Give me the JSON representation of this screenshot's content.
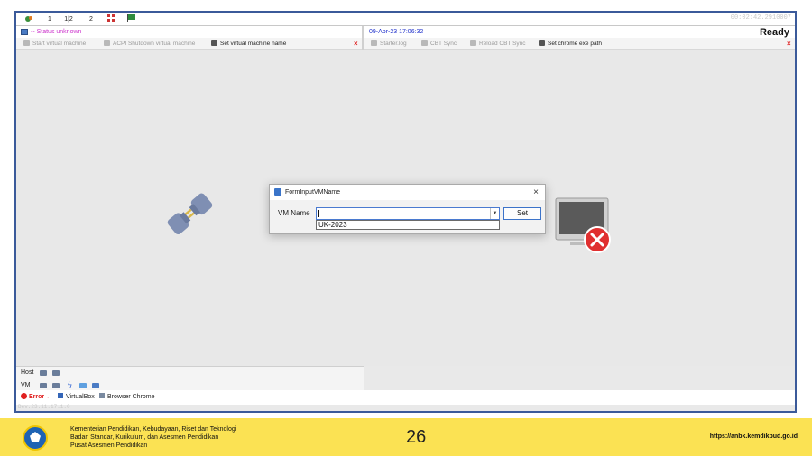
{
  "topbar": {
    "tabs": [
      "1",
      "1|2",
      "2"
    ],
    "clock": "00:02:42.2910007"
  },
  "status": {
    "left_text": "-- Status unknown",
    "datetime": "09-Apr-23 17:06:32",
    "ready": "Ready"
  },
  "toolbar_left": {
    "start_vm": "Start virtual machine",
    "acpi_shutdown": "ACPI Shutdown virtual machine",
    "set_vm_name": "Set virtual machine name",
    "close": "×"
  },
  "toolbar_right": {
    "starter_log": "Starter.log",
    "cbt_sync": "CBT Sync",
    "reload_cbt_sync": "Reload CBT Sync",
    "set_chrome_path": "Set chrome exe path",
    "close": "×"
  },
  "bottom": {
    "host_label": "Host",
    "vm_label": "VM",
    "error": "Error ←",
    "virtualbox": "VirtualBox",
    "browser_chrome": "Browser Chrome",
    "version": "Dev.23.11.17.1.0"
  },
  "dialog": {
    "title": "FormInputVMName",
    "close": "×",
    "vm_name_label": "VM Name",
    "input_value": "",
    "dropdown_option": "UK-2023",
    "set_label": "Set"
  },
  "footer": {
    "ministry_line1": "Kementerian Pendidikan, Kebudayaan, Riset dan Teknologi",
    "ministry_line2": "Badan Standar, Kurikulum, dan Asesmen Pendidikan",
    "ministry_line3": "Pusat Asesmen Pendidikan",
    "page_number": "26",
    "url": "https://anbk.kemdikbud.go.id"
  },
  "colors": {
    "window_border": "#3b5a9a",
    "status_unknown": "#cc33cc",
    "datetime": "#2233cc",
    "error_red": "#e02020",
    "footer_bg": "#fbe253"
  },
  "icons": [
    "app-icon",
    "flag-icon",
    "monitor-icon",
    "plug-icon",
    "error-x-icon",
    "logo-emblem"
  ]
}
